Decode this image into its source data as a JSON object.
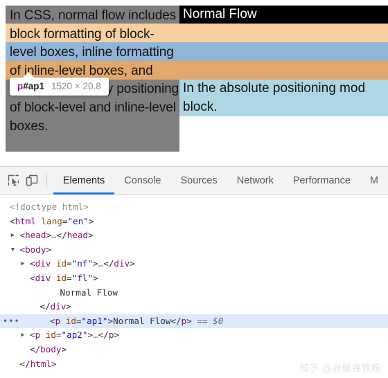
{
  "viewport": {
    "dim_paragraph": "In CSS, normal flow includes block formatting of block-level boxes, inline formatting of inline-level boxes, and relative and sticky positioning of block-level and inline-level boxes.",
    "doc": {
      "nf_text": "Normal Flow",
      "fl_text": "Normal Flow",
      "ap2_text": "In the absolute positioning mod block."
    },
    "tooltip": {
      "tag": "p",
      "id": "#ap1",
      "dimensions": "1520 × 20.8"
    },
    "colors": {
      "dim_overlay": "#7f7f7f",
      "margin_band": "#f7cfa1",
      "content_band": "#8fb5d9",
      "nf_background": "#000000",
      "fl_background": "#a7c48c",
      "ap2_background": "#aed7e4"
    }
  },
  "devtools": {
    "buttons": [
      {
        "name": "inspect-element-button",
        "icon": "inspect-cursor-icon",
        "title": "Inspect element"
      },
      {
        "name": "device-toolbar-button",
        "icon": "device-toolbar-icon",
        "title": "Toggle device toolbar"
      }
    ],
    "tabs": [
      {
        "label": "Elements",
        "active": true
      },
      {
        "label": "Console",
        "active": false
      },
      {
        "label": "Sources",
        "active": false
      },
      {
        "label": "Network",
        "active": false
      },
      {
        "label": "Performance",
        "active": false
      },
      {
        "label": "M",
        "active": false
      }
    ],
    "accent_color": "#1a73e8",
    "selection_color": "#dceafc",
    "tree": [
      {
        "id": "doctype",
        "indent": 0,
        "twisty": "none",
        "selected": false,
        "parts": [
          {
            "t": "el",
            "v": "<!doctype html>"
          }
        ]
      },
      {
        "id": "html-open",
        "indent": 0,
        "twisty": "none",
        "selected": false,
        "parts": [
          {
            "t": "pn",
            "v": "<"
          },
          {
            "t": "pk",
            "v": "html"
          },
          {
            "t": "pn",
            "v": " "
          },
          {
            "t": "at",
            "v": "lang"
          },
          {
            "t": "pn",
            "v": "="
          },
          {
            "t": "av",
            "v": "\"en\""
          },
          {
            "t": "pn",
            "v": ">"
          }
        ]
      },
      {
        "id": "head",
        "indent": 1,
        "twisty": "closed",
        "selected": false,
        "parts": [
          {
            "t": "pn",
            "v": "<"
          },
          {
            "t": "pk",
            "v": "head"
          },
          {
            "t": "pn",
            "v": ">"
          },
          {
            "t": "el",
            "v": "…"
          },
          {
            "t": "pn",
            "v": "</"
          },
          {
            "t": "pk",
            "v": "head"
          },
          {
            "t": "pn",
            "v": ">"
          }
        ]
      },
      {
        "id": "body-open",
        "indent": 1,
        "twisty": "open",
        "selected": false,
        "parts": [
          {
            "t": "pn",
            "v": "<"
          },
          {
            "t": "pk",
            "v": "body"
          },
          {
            "t": "pn",
            "v": ">"
          }
        ]
      },
      {
        "id": "div-nf",
        "indent": 2,
        "twisty": "closed",
        "selected": false,
        "parts": [
          {
            "t": "pn",
            "v": "<"
          },
          {
            "t": "pk",
            "v": "div"
          },
          {
            "t": "pn",
            "v": " "
          },
          {
            "t": "at",
            "v": "id"
          },
          {
            "t": "pn",
            "v": "="
          },
          {
            "t": "av",
            "v": "\"nf\""
          },
          {
            "t": "pn",
            "v": ">"
          },
          {
            "t": "el",
            "v": "…"
          },
          {
            "t": "pn",
            "v": "</"
          },
          {
            "t": "pk",
            "v": "div"
          },
          {
            "t": "pn",
            "v": ">"
          }
        ]
      },
      {
        "id": "div-fl-open",
        "indent": 2,
        "twisty": "none",
        "selected": false,
        "parts": [
          {
            "t": "pn",
            "v": "<"
          },
          {
            "t": "pk",
            "v": "div"
          },
          {
            "t": "pn",
            "v": " "
          },
          {
            "t": "at",
            "v": "id"
          },
          {
            "t": "pn",
            "v": "="
          },
          {
            "t": "av",
            "v": "\"fl\""
          },
          {
            "t": "pn",
            "v": ">"
          }
        ]
      },
      {
        "id": "div-fl-text",
        "indent": 5,
        "twisty": "none",
        "selected": false,
        "parts": [
          {
            "t": "tx",
            "v": "Normal Flow"
          }
        ]
      },
      {
        "id": "div-fl-close",
        "indent": 3,
        "twisty": "none",
        "selected": false,
        "parts": [
          {
            "t": "pn",
            "v": "</"
          },
          {
            "t": "pk",
            "v": "div"
          },
          {
            "t": "pn",
            "v": ">"
          }
        ]
      },
      {
        "id": "p-ap1",
        "indent": 4,
        "twisty": "dots",
        "selected": true,
        "parts": [
          {
            "t": "pn",
            "v": "<"
          },
          {
            "t": "pk",
            "v": "p"
          },
          {
            "t": "pn",
            "v": " "
          },
          {
            "t": "at",
            "v": "id"
          },
          {
            "t": "pn",
            "v": "="
          },
          {
            "t": "av",
            "v": "\"ap1\""
          },
          {
            "t": "pn",
            "v": ">"
          },
          {
            "t": "tx",
            "v": "Normal Flow"
          },
          {
            "t": "pn",
            "v": "</"
          },
          {
            "t": "pk",
            "v": "p"
          },
          {
            "t": "pn",
            "v": ">"
          },
          {
            "t": "ref",
            "v": " == $0"
          }
        ]
      },
      {
        "id": "p-ap2",
        "indent": 2,
        "twisty": "closed",
        "selected": false,
        "parts": [
          {
            "t": "pn",
            "v": "<"
          },
          {
            "t": "pk",
            "v": "p"
          },
          {
            "t": "pn",
            "v": " "
          },
          {
            "t": "at",
            "v": "id"
          },
          {
            "t": "pn",
            "v": "="
          },
          {
            "t": "av",
            "v": "\"ap2\""
          },
          {
            "t": "pn",
            "v": ">"
          },
          {
            "t": "el",
            "v": "…"
          },
          {
            "t": "pn",
            "v": "</"
          },
          {
            "t": "pk",
            "v": "p"
          },
          {
            "t": "pn",
            "v": ">"
          }
        ]
      },
      {
        "id": "body-close",
        "indent": 2,
        "twisty": "none",
        "selected": false,
        "parts": [
          {
            "t": "pn",
            "v": "</"
          },
          {
            "t": "pk",
            "v": "body"
          },
          {
            "t": "pn",
            "v": ">"
          }
        ]
      },
      {
        "id": "html-close",
        "indent": 1,
        "twisty": "none",
        "selected": false,
        "parts": [
          {
            "t": "pn",
            "v": "</"
          },
          {
            "t": "pk",
            "v": "html"
          },
          {
            "t": "pn",
            "v": ">"
          }
        ]
      }
    ]
  },
  "watermark": "知乎 @尚硅谷铁粉"
}
